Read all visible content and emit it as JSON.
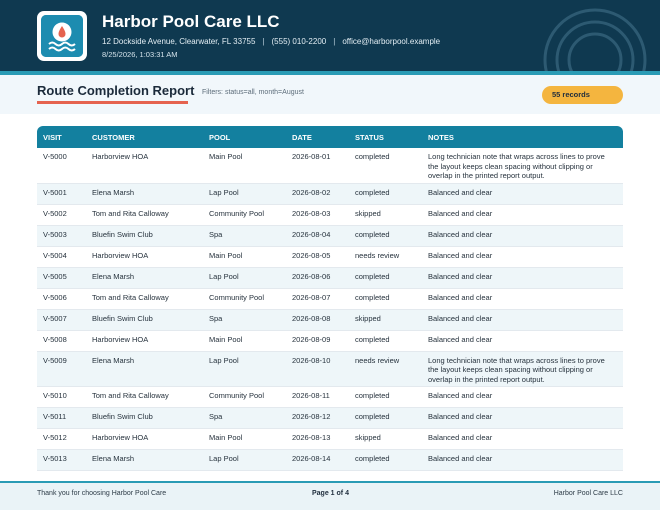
{
  "header": {
    "company_name": "Harbor Pool Care LLC",
    "address": "12 Dockside Avenue, Clearwater, FL 33755",
    "separator": "|",
    "phone": "(555) 010-2200",
    "email": "office@harborpool.example",
    "generated_at": "8/25/2026, 1:03:31 AM",
    "logo_icon": "water-drop-waves-icon"
  },
  "report": {
    "title": "Route Completion Report",
    "filters": "Filters: status=all, month=August",
    "record_count": "55 records"
  },
  "table": {
    "columns": [
      "VISIT",
      "CUSTOMER",
      "POOL",
      "DATE",
      "STATUS",
      "NOTES"
    ],
    "rows": [
      [
        "V-5000",
        "Harborview HOA",
        "Main Pool",
        "2026-08-01",
        "completed",
        "Long technician note that wraps across lines to prove the layout keeps clean spacing without clipping or overlap in the printed report output."
      ],
      [
        "V-5001",
        "Elena Marsh",
        "Lap Pool",
        "2026-08-02",
        "completed",
        "Balanced and clear"
      ],
      [
        "V-5002",
        "Tom and Rita Calloway",
        "Community Pool",
        "2026-08-03",
        "skipped",
        "Balanced and clear"
      ],
      [
        "V-5003",
        "Bluefin Swim Club",
        "Spa",
        "2026-08-04",
        "completed",
        "Balanced and clear"
      ],
      [
        "V-5004",
        "Harborview HOA",
        "Main Pool",
        "2026-08-05",
        "needs review",
        "Balanced and clear"
      ],
      [
        "V-5005",
        "Elena Marsh",
        "Lap Pool",
        "2026-08-06",
        "completed",
        "Balanced and clear"
      ],
      [
        "V-5006",
        "Tom and Rita Calloway",
        "Community Pool",
        "2026-08-07",
        "completed",
        "Balanced and clear"
      ],
      [
        "V-5007",
        "Bluefin Swim Club",
        "Spa",
        "2026-08-08",
        "skipped",
        "Balanced and clear"
      ],
      [
        "V-5008",
        "Harborview HOA",
        "Main Pool",
        "2026-08-09",
        "completed",
        "Balanced and clear"
      ],
      [
        "V-5009",
        "Elena Marsh",
        "Lap Pool",
        "2026-08-10",
        "needs review",
        "Long technician note that wraps across lines to prove the layout keeps clean spacing without clipping or overlap in the printed report output."
      ],
      [
        "V-5010",
        "Tom and Rita Calloway",
        "Community Pool",
        "2026-08-11",
        "completed",
        "Balanced and clear"
      ],
      [
        "V-5011",
        "Bluefin Swim Club",
        "Spa",
        "2026-08-12",
        "completed",
        "Balanced and clear"
      ],
      [
        "V-5012",
        "Harborview HOA",
        "Main Pool",
        "2026-08-13",
        "skipped",
        "Balanced and clear"
      ],
      [
        "V-5013",
        "Elena Marsh",
        "Lap Pool",
        "2026-08-14",
        "completed",
        "Balanced and clear"
      ]
    ]
  },
  "footer": {
    "thanks": "Thank you for choosing Harbor Pool Care",
    "page": "Page 1 of 4",
    "company": "Harbor Pool Care LLC"
  },
  "colors": {
    "header_bg": "#0f3950",
    "accent_teal": "#13809f",
    "title_underline": "#e5634f",
    "badge": "#f4b53f"
  }
}
